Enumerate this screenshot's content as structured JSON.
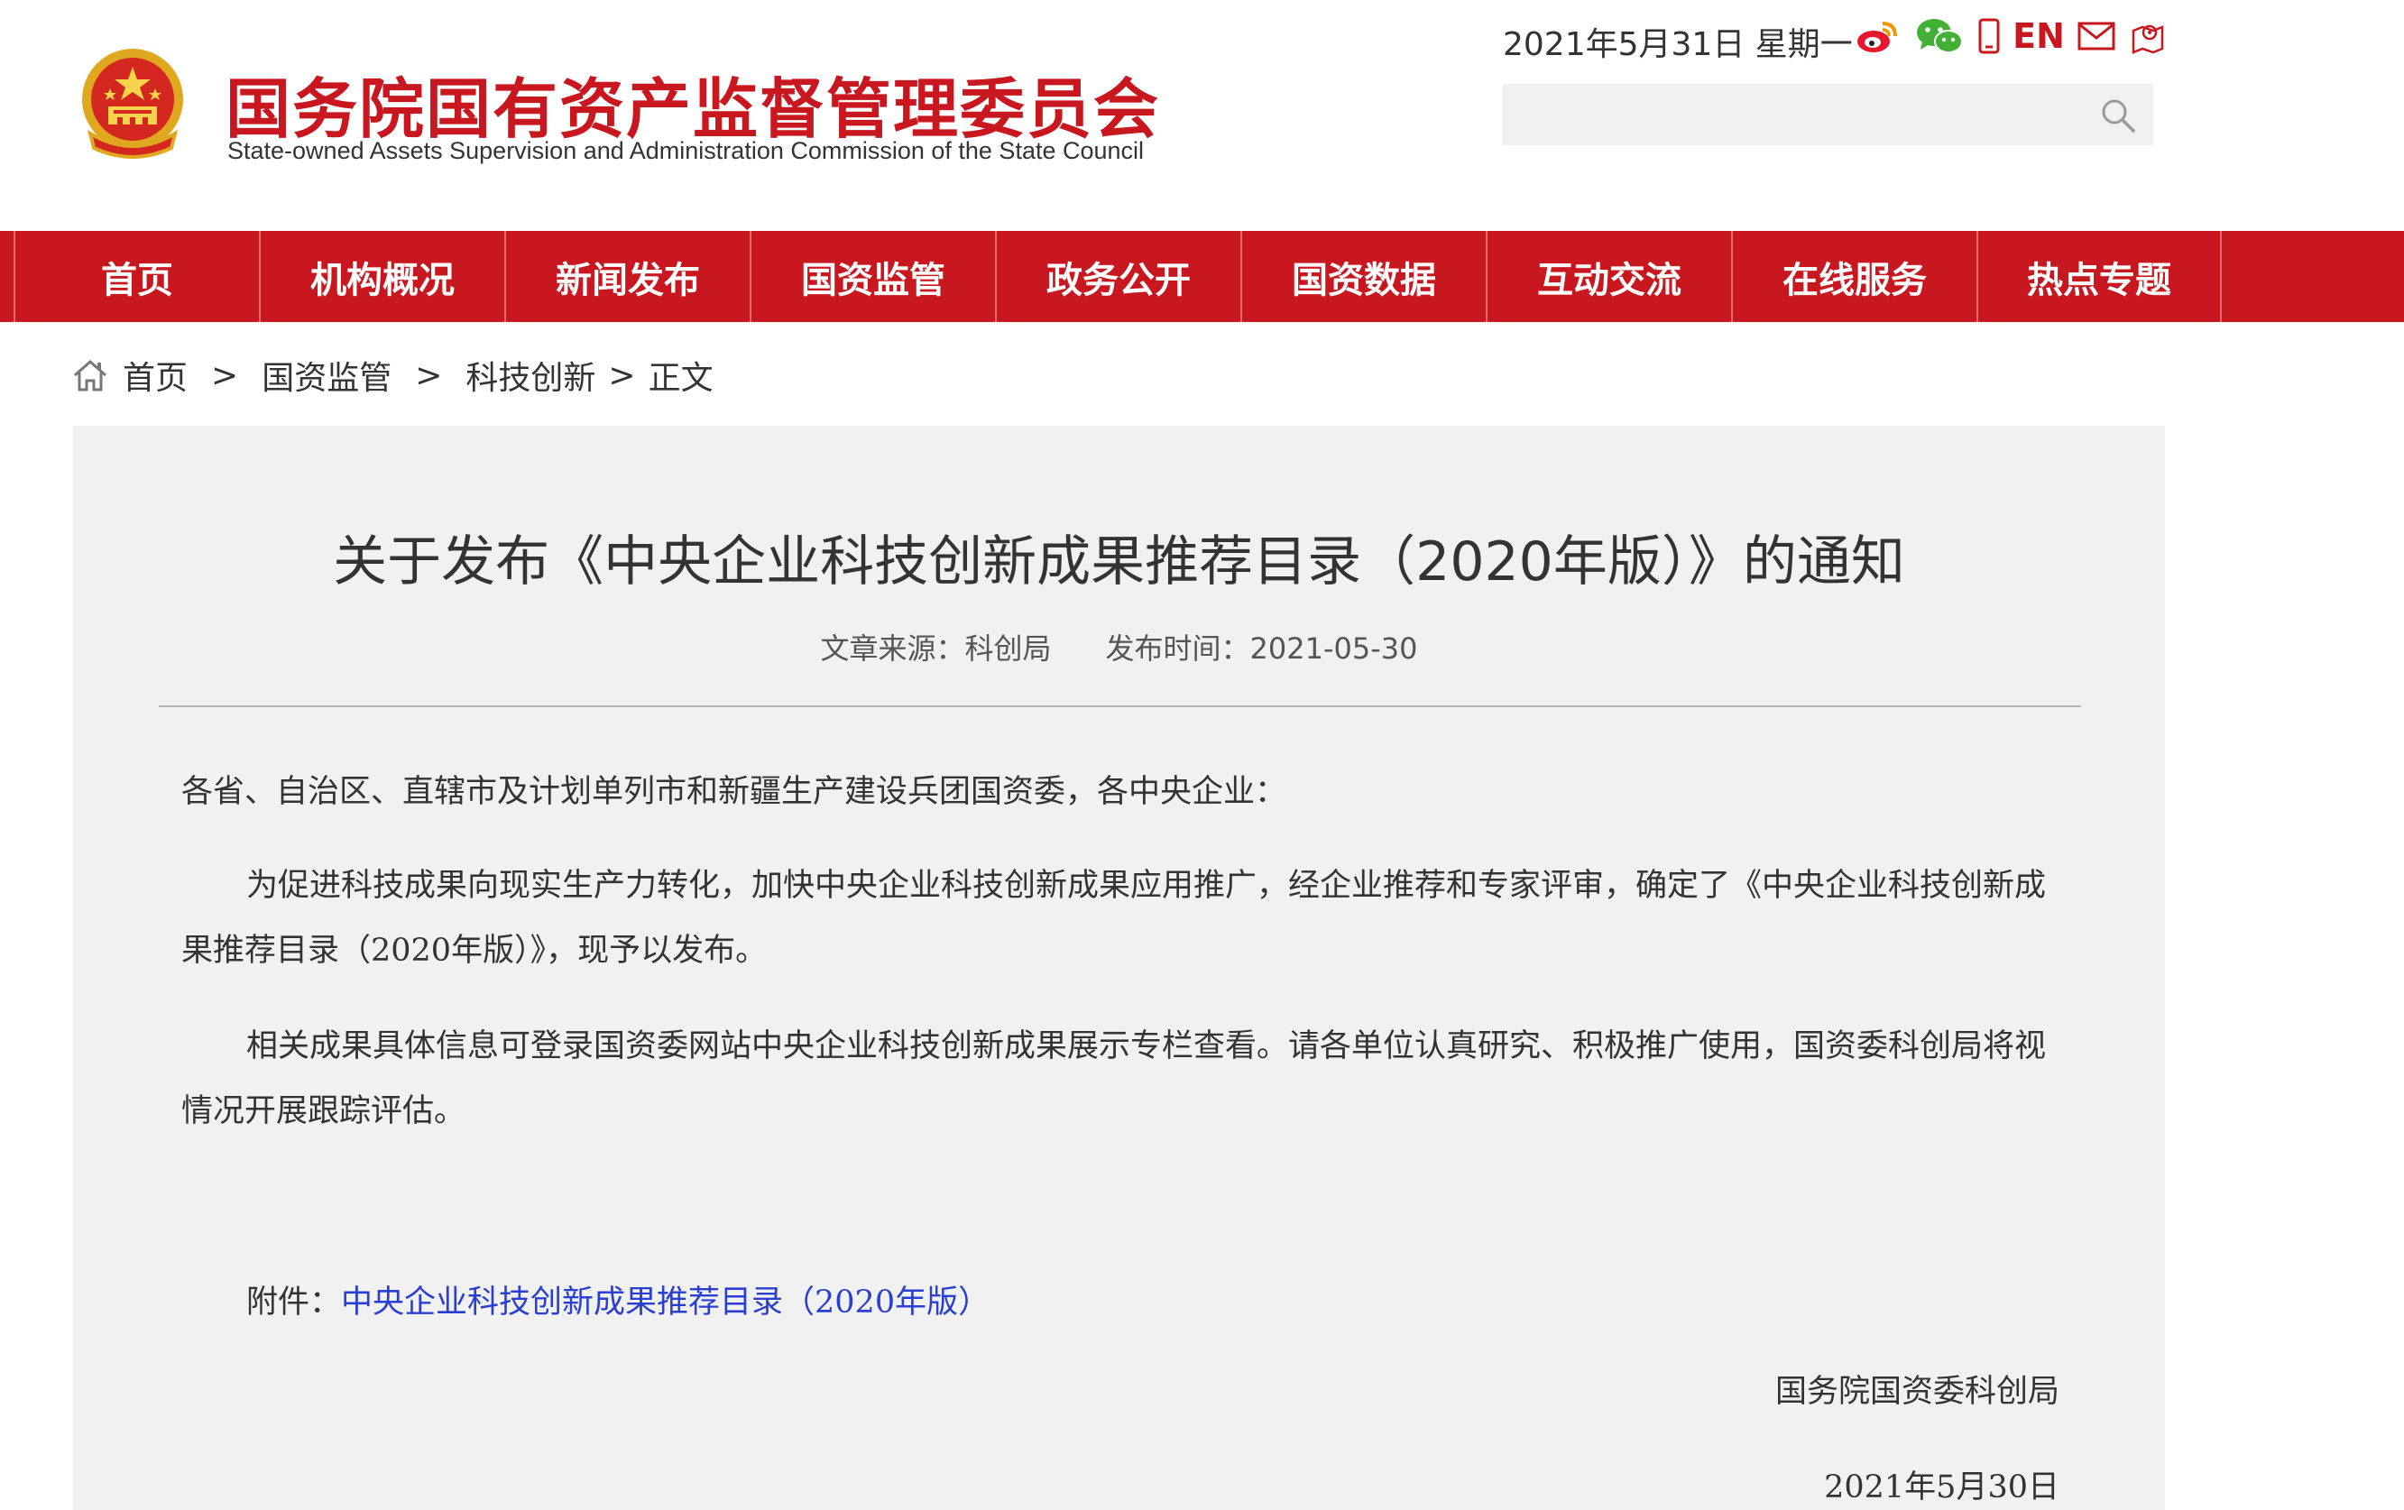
{
  "header": {
    "site_title": "国务院国有资产监督管理委员会",
    "site_subtitle": "State-owned Assets Supervision and Administration Commission of the State Council",
    "date": "2021年5月31日 星期一",
    "en_label": "EN",
    "search_placeholder": "",
    "icons": [
      "weibo-icon",
      "wechat-icon",
      "mobile-icon",
      "mail-icon",
      "map-icon",
      "search-icon"
    ],
    "brand_color": "#c8171e"
  },
  "nav": {
    "items": [
      "首页",
      "机构概况",
      "新闻发布",
      "国资监管",
      "政务公开",
      "国资数据",
      "互动交流",
      "在线服务",
      "热点专题"
    ]
  },
  "breadcrumb": {
    "home": "首页",
    "level1": "国资监管",
    "level2": "科技创新",
    "current": "正文",
    "separator": ">"
  },
  "article": {
    "title": "关于发布《中央企业科技创新成果推荐目录（2020年版）》的通知",
    "source": "文章来源：科创局",
    "published": "发布时间：2021-05-30",
    "salutation": "各省、自治区、直辖市及计划单列市和新疆生产建设兵团国资委，各中央企业：",
    "paragraph1": "为促进科技成果向现实生产力转化，加快中央企业科技创新成果应用推广，经企业推荐和专家评审，确定了《中央企业科技创新成果推荐目录（2020年版）》，现予以发布。",
    "paragraph2": "相关成果具体信息可登录国资委网站中央企业科技创新成果展示专栏查看。请各单位认真研究、积极推广使用，国资委科创局将视情况开展跟踪评估。",
    "attachment_label": "附件：",
    "attachment_link": "中央企业科技创新成果推荐目录（2020年版）",
    "signer": "国务院国资委科创局",
    "sign_date": "2021年5月30日",
    "link_color": "#2a3fd1"
  }
}
